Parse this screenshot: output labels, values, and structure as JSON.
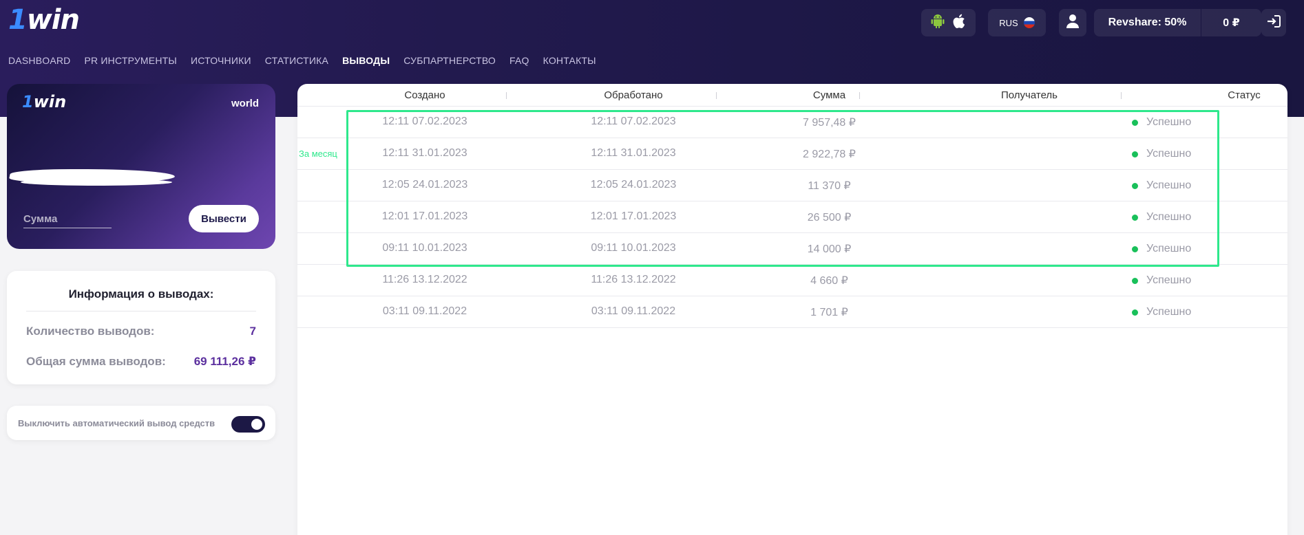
{
  "brand": {
    "logo_one": "1",
    "logo_win": "win"
  },
  "nav": [
    {
      "label": "DASHBOARD"
    },
    {
      "label": "PR ИНСТРУМЕНТЫ"
    },
    {
      "label": "ИСТОЧНИКИ"
    },
    {
      "label": "СТАТИСТИКА"
    },
    {
      "label": "ВЫВОДЫ",
      "active": true
    },
    {
      "label": "СУБПАРТНЕРСТВО"
    },
    {
      "label": "FAQ"
    },
    {
      "label": "КОНТАКТЫ"
    }
  ],
  "header": {
    "language": "RUS",
    "revshare": "Revshare: 50%",
    "balance": "0 ₽"
  },
  "card": {
    "logo_one": "1",
    "logo_win": "win",
    "world": "world",
    "amount_placeholder": "Сумма",
    "withdraw_button": "Вывести"
  },
  "info": {
    "title": "Информация о выводах:",
    "count_label": "Количество выводов:",
    "count_value": "7",
    "total_label": "Общая сумма выводов:",
    "total_value": "69 111,26 ₽"
  },
  "auto_withdraw": {
    "label": "Выключить автоматический вывод средств",
    "enabled": true
  },
  "table": {
    "headers": {
      "created": "Создано",
      "processed": "Обработано",
      "amount": "Сумма",
      "recipient": "Получатель",
      "status": "Статус"
    },
    "rows": [
      {
        "created": "12:11 07.02.2023",
        "processed": "12:11 07.02.2023",
        "amount": "7 957,48 ₽",
        "status": "Успешно"
      },
      {
        "created": "12:11 31.01.2023",
        "processed": "12:11 31.01.2023",
        "amount": "2 922,78 ₽",
        "status": "Успешно"
      },
      {
        "created": "12:05 24.01.2023",
        "processed": "12:05 24.01.2023",
        "amount": "11 370 ₽",
        "status": "Успешно"
      },
      {
        "created": "12:01 17.01.2023",
        "processed": "12:01 17.01.2023",
        "amount": "26 500 ₽",
        "status": "Успешно"
      },
      {
        "created": "09:11 10.01.2023",
        "processed": "09:11 10.01.2023",
        "amount": "14 000 ₽",
        "status": "Успешно"
      },
      {
        "created": "11:26 13.12.2022",
        "processed": "11:26 13.12.2022",
        "amount": "4 660 ₽",
        "status": "Успешно"
      },
      {
        "created": "03:11 09.11.2022",
        "processed": "03:11 09.11.2022",
        "amount": "1 701 ₽",
        "status": "Успешно"
      }
    ]
  },
  "annotation": {
    "label": "За месяц",
    "color": "#2ee88c"
  },
  "colors": {
    "accent": "#5b2f9e",
    "success": "#19c05a",
    "header_bg": "#221a4e"
  }
}
